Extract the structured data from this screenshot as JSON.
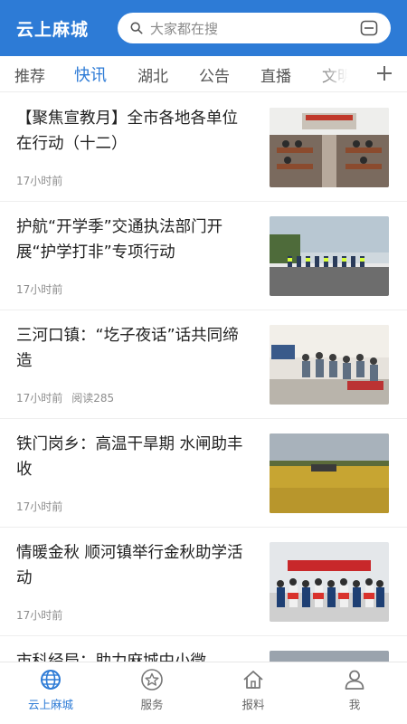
{
  "header": {
    "app_title": "云上麻城",
    "search_placeholder": "大家都在搜"
  },
  "tabs": [
    {
      "label": "推荐",
      "active": false
    },
    {
      "label": "快讯",
      "active": true
    },
    {
      "label": "湖北",
      "active": false
    },
    {
      "label": "公告",
      "active": false
    },
    {
      "label": "直播",
      "active": false
    },
    {
      "label": "文明",
      "active": false
    }
  ],
  "feed": [
    {
      "title": "【聚焦宣教月】全市各地各单位在行动（十二）",
      "time": "17小时前",
      "reads": "",
      "thumb": "meeting-room"
    },
    {
      "title": "护航“开学季”交通执法部门开展“护学打非”专项行动",
      "time": "17小时前",
      "reads": "",
      "thumb": "roadside-police"
    },
    {
      "title": "三河口镇：“圪子夜话”话共同缔造",
      "time": "17小时前",
      "reads": "阅读285",
      "thumb": "village-meeting"
    },
    {
      "title": "铁门岗乡：高温干旱期 水闸助丰收",
      "time": "17小时前",
      "reads": "",
      "thumb": "rice-field"
    },
    {
      "title": "情暖金秋 顺河镇举行金秋助学活动",
      "time": "17小时前",
      "reads": "",
      "thumb": "group-photo"
    },
    {
      "title": "市科经局：助力麻城中小微",
      "time": "",
      "reads": "",
      "thumb": "partial"
    }
  ],
  "bottom_nav": [
    {
      "label": "云上麻城",
      "icon": "globe-icon",
      "active": true
    },
    {
      "label": "服务",
      "icon": "star-icon",
      "active": false
    },
    {
      "label": "报料",
      "icon": "home-icon",
      "active": false
    },
    {
      "label": "我",
      "icon": "user-icon",
      "active": false
    }
  ],
  "colors": {
    "brand": "#2d7bd6",
    "text": "#222222",
    "meta": "#8d8d8d"
  }
}
